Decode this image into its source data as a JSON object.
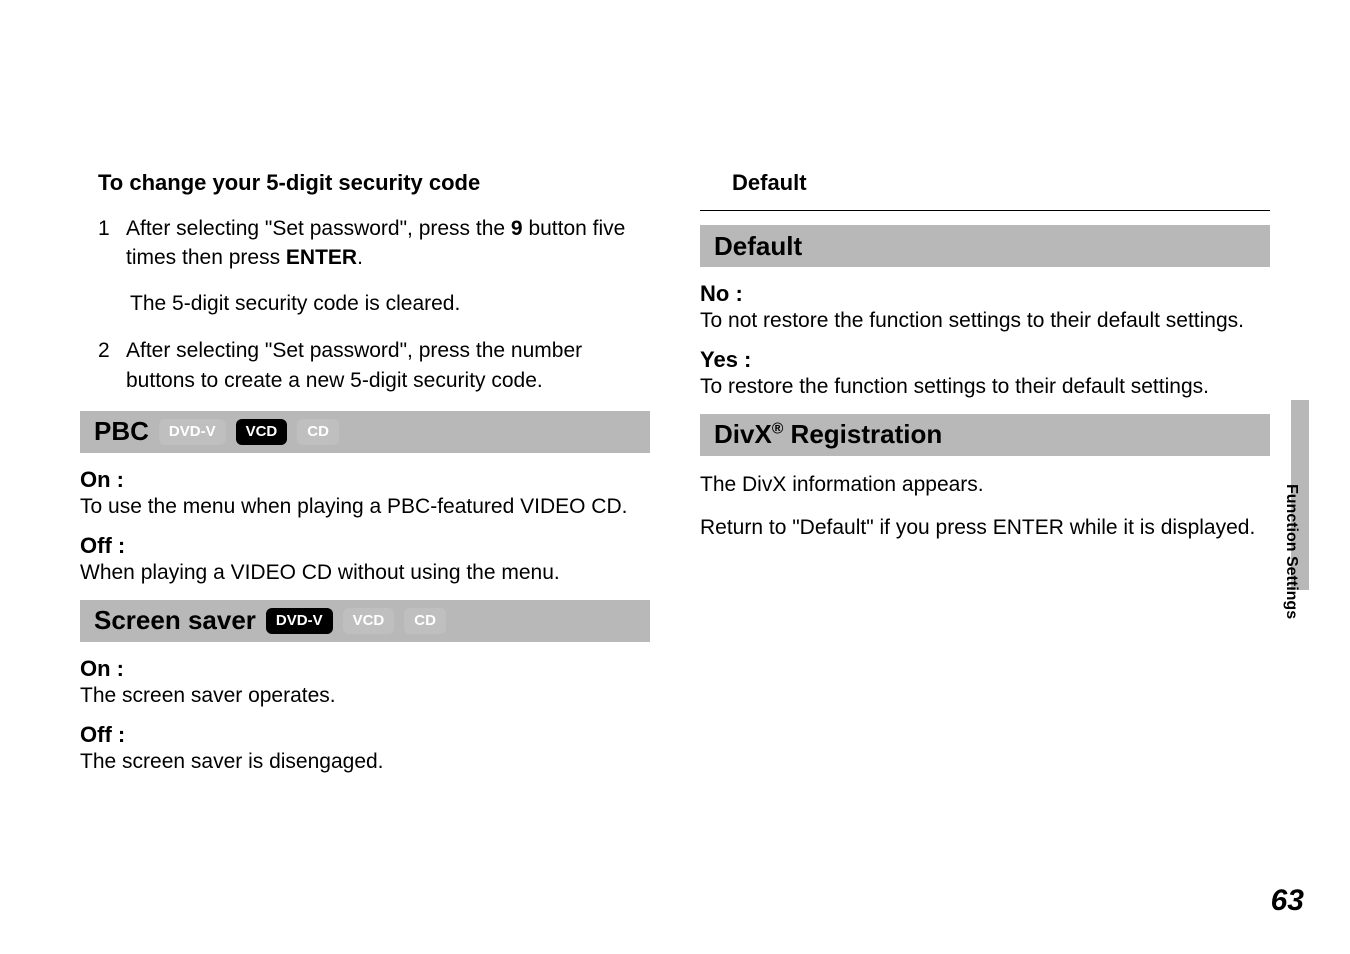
{
  "left": {
    "topHeading": "To change your 5-digit security code",
    "step1_pre": "After selecting \"Set password\", press the ",
    "step1_bold": "9",
    "step1_post": " button five times then press ",
    "step1_enter": "ENTER",
    "step1_period": ".",
    "step1_result": "The 5-digit security code is cleared.",
    "step2": "After selecting \"Set password\", press the number buttons to create a new 5-digit security code.",
    "pbc": {
      "title": "PBC",
      "badges": [
        "DVD-V",
        "VCD",
        "CD"
      ],
      "on_label": "On :",
      "on_desc": "To use the menu when playing a PBC-featured VIDEO CD.",
      "off_label": "Off :",
      "off_desc": "When playing a VIDEO CD without using the menu."
    },
    "ss": {
      "title": "Screen saver",
      "badges": [
        "DVD-V",
        "VCD",
        "CD"
      ],
      "on_label": "On :",
      "on_desc": "The screen saver operates.",
      "off_label": "Off :",
      "off_desc": "The screen saver is disengaged."
    }
  },
  "right": {
    "topLabel": "Default",
    "default": {
      "title": "Default",
      "no_label": "No :",
      "no_desc": "To not restore the function settings to their default settings.",
      "yes_label": "Yes :",
      "yes_desc": "To restore the function settings to their default settings."
    },
    "divx": {
      "title_pre": "DivX",
      "title_sup": "®",
      "title_post": " Registration",
      "line1": "The DivX information appears.",
      "line2": "Return to \"Default\" if you press ENTER while it is displayed."
    }
  },
  "sideLabel": "Function Settings",
  "pageNumber": "63",
  "numbers": {
    "one": "1",
    "two": "2"
  }
}
